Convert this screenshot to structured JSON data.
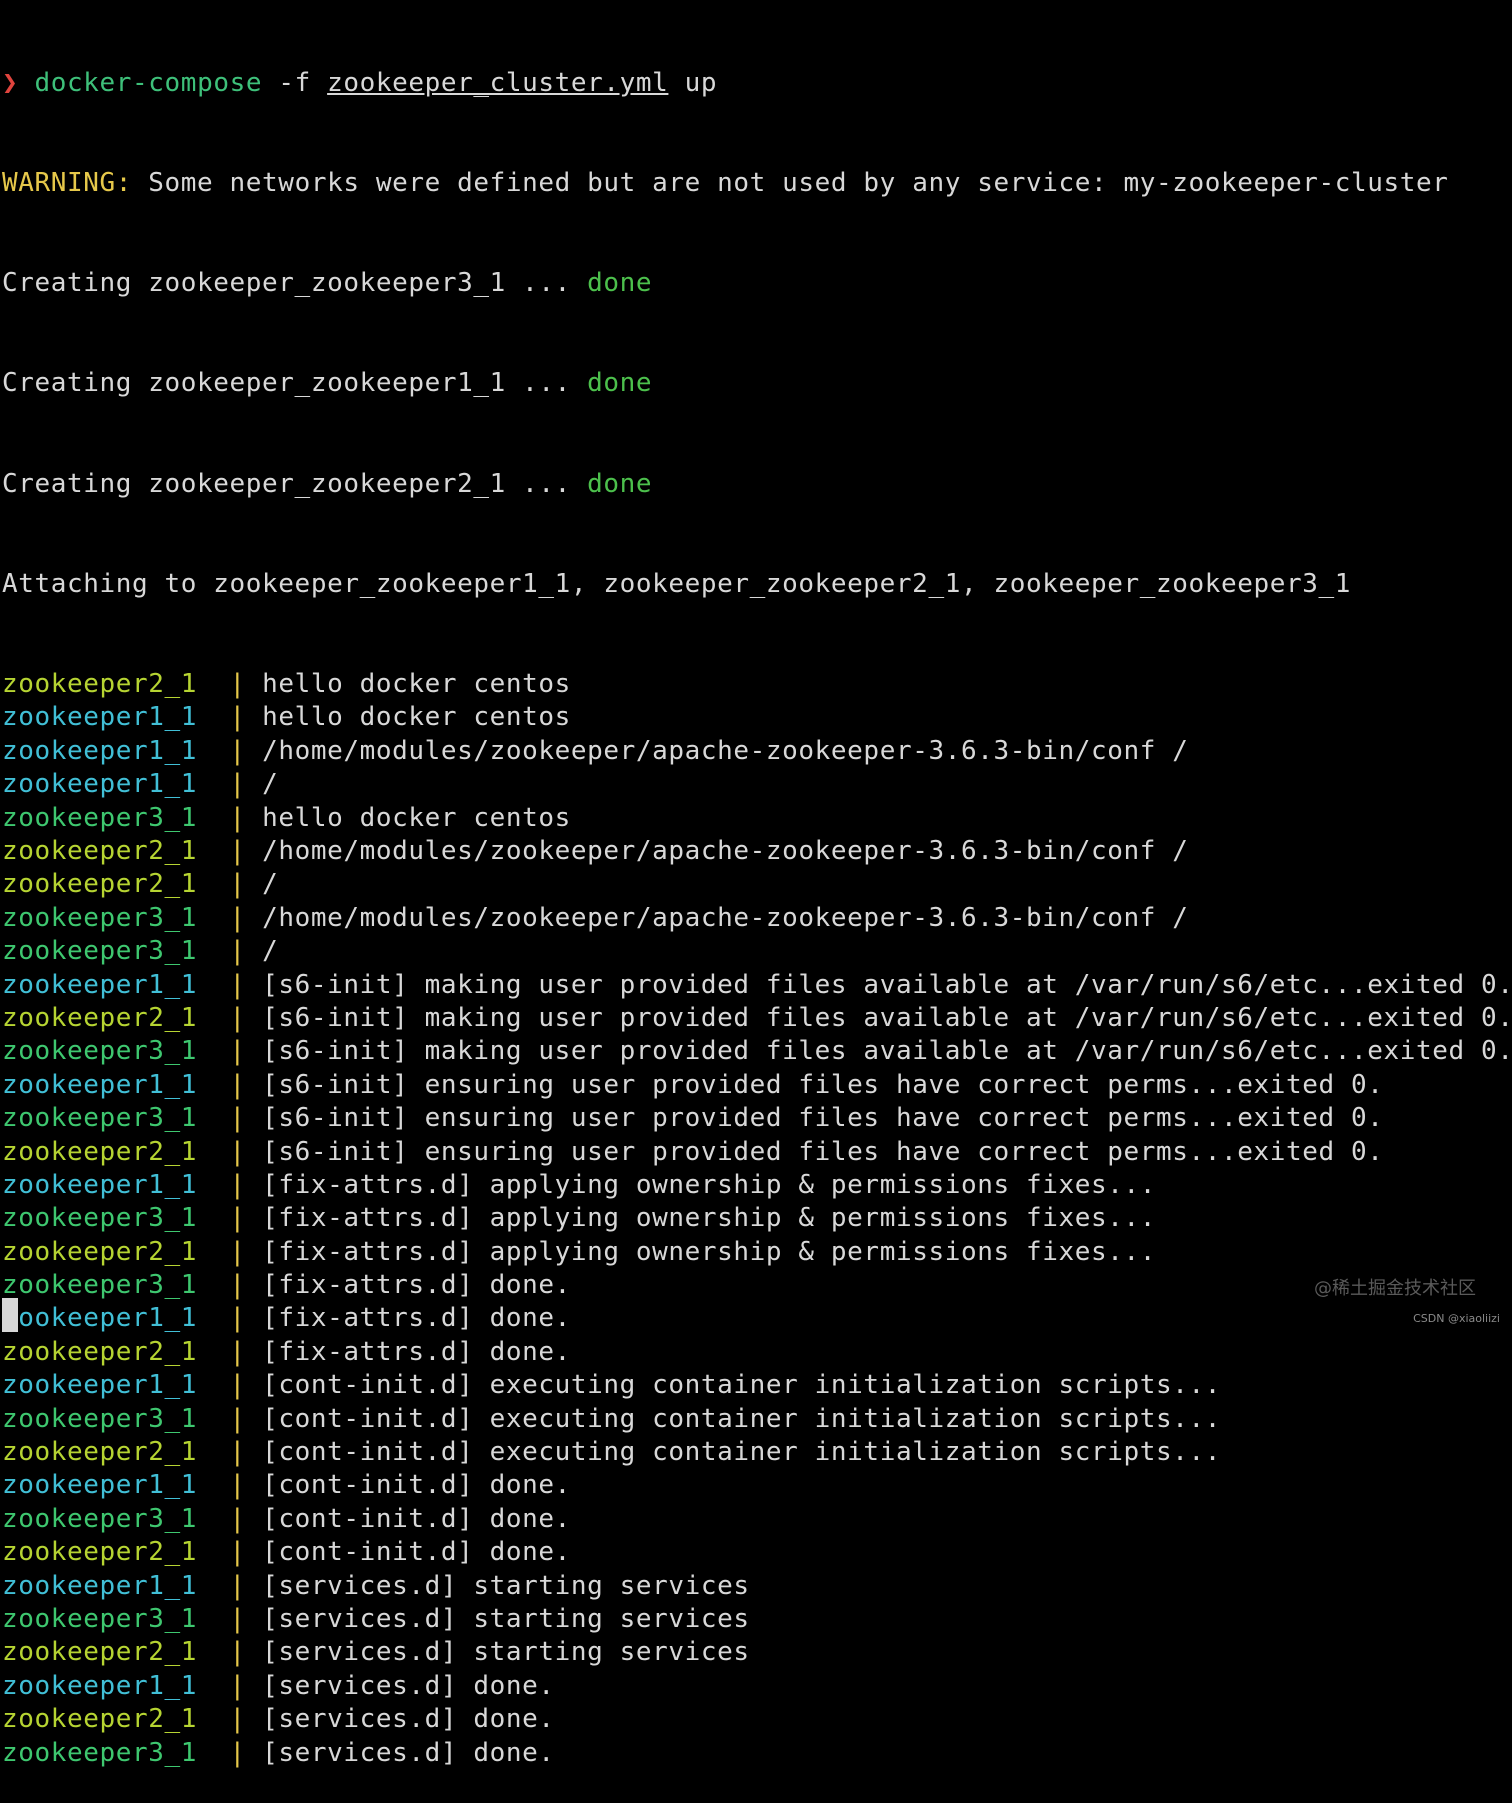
{
  "terminal": {
    "prompt_symbol": "❯",
    "command": {
      "program": "docker-compose",
      "flag": " -f ",
      "file": "zookeeper_cluster.yml",
      "action": " up"
    },
    "warning": {
      "label": "WARNING:",
      "message": " Some networks were defined but are not used by any service: my-zookeeper-cluster"
    },
    "creating": [
      {
        "prefix": "Creating zookeeper_zookeeper3_1 ... ",
        "status": "done"
      },
      {
        "prefix": "Creating zookeeper_zookeeper1_1 ... ",
        "status": "done"
      },
      {
        "prefix": "Creating zookeeper_zookeeper2_1 ... ",
        "status": "done"
      }
    ],
    "attaching": "Attaching to zookeeper_zookeeper1_1, zookeeper_zookeeper2_1, zookeeper_zookeeper3_1",
    "separator": "  | ",
    "logs": [
      {
        "service": "zookeeper2_1",
        "message": "hello docker centos"
      },
      {
        "service": "zookeeper1_1",
        "message": "hello docker centos"
      },
      {
        "service": "zookeeper1_1",
        "message": "/home/modules/zookeeper/apache-zookeeper-3.6.3-bin/conf /"
      },
      {
        "service": "zookeeper1_1",
        "message": "/"
      },
      {
        "service": "zookeeper3_1",
        "message": "hello docker centos"
      },
      {
        "service": "zookeeper2_1",
        "message": "/home/modules/zookeeper/apache-zookeeper-3.6.3-bin/conf /"
      },
      {
        "service": "zookeeper2_1",
        "message": "/"
      },
      {
        "service": "zookeeper3_1",
        "message": "/home/modules/zookeeper/apache-zookeeper-3.6.3-bin/conf /"
      },
      {
        "service": "zookeeper3_1",
        "message": "/"
      },
      {
        "service": "zookeeper1_1",
        "message": "[s6-init] making user provided files available at /var/run/s6/etc...exited 0."
      },
      {
        "service": "zookeeper2_1",
        "message": "[s6-init] making user provided files available at /var/run/s6/etc...exited 0."
      },
      {
        "service": "zookeeper3_1",
        "message": "[s6-init] making user provided files available at /var/run/s6/etc...exited 0."
      },
      {
        "service": "zookeeper1_1",
        "message": "[s6-init] ensuring user provided files have correct perms...exited 0."
      },
      {
        "service": "zookeeper3_1",
        "message": "[s6-init] ensuring user provided files have correct perms...exited 0."
      },
      {
        "service": "zookeeper2_1",
        "message": "[s6-init] ensuring user provided files have correct perms...exited 0."
      },
      {
        "service": "zookeeper1_1",
        "message": "[fix-attrs.d] applying ownership & permissions fixes..."
      },
      {
        "service": "zookeeper3_1",
        "message": "[fix-attrs.d] applying ownership & permissions fixes..."
      },
      {
        "service": "zookeeper2_1",
        "message": "[fix-attrs.d] applying ownership & permissions fixes..."
      },
      {
        "service": "zookeeper3_1",
        "message": "[fix-attrs.d] done."
      },
      {
        "service": "zookeeper1_1",
        "message": "[fix-attrs.d] done."
      },
      {
        "service": "zookeeper2_1",
        "message": "[fix-attrs.d] done."
      },
      {
        "service": "zookeeper1_1",
        "message": "[cont-init.d] executing container initialization scripts..."
      },
      {
        "service": "zookeeper3_1",
        "message": "[cont-init.d] executing container initialization scripts..."
      },
      {
        "service": "zookeeper2_1",
        "message": "[cont-init.d] executing container initialization scripts..."
      },
      {
        "service": "zookeeper1_1",
        "message": "[cont-init.d] done."
      },
      {
        "service": "zookeeper3_1",
        "message": "[cont-init.d] done."
      },
      {
        "service": "zookeeper2_1",
        "message": "[cont-init.d] done."
      },
      {
        "service": "zookeeper1_1",
        "message": "[services.d] starting services"
      },
      {
        "service": "zookeeper3_1",
        "message": "[services.d] starting services"
      },
      {
        "service": "zookeeper2_1",
        "message": "[services.d] starting services"
      },
      {
        "service": "zookeeper1_1",
        "message": "[services.d] done."
      },
      {
        "service": "zookeeper2_1",
        "message": "[services.d] done."
      },
      {
        "service": "zookeeper3_1",
        "message": "[services.d] done."
      }
    ]
  },
  "colors": {
    "background": "#000000",
    "text": "#d8d8d8",
    "prompt": "#e0443e",
    "command": "#3ec07a",
    "warning": "#e6c84a",
    "done": "#4cc04c",
    "zookeeper1_1": "#41bfd6",
    "zookeeper2_1": "#b6d432",
    "zookeeper3_1": "#3ec76f"
  },
  "watermark": {
    "site": "@稀土掘金技术社区",
    "author": "CSDN @xiaoliizi"
  }
}
